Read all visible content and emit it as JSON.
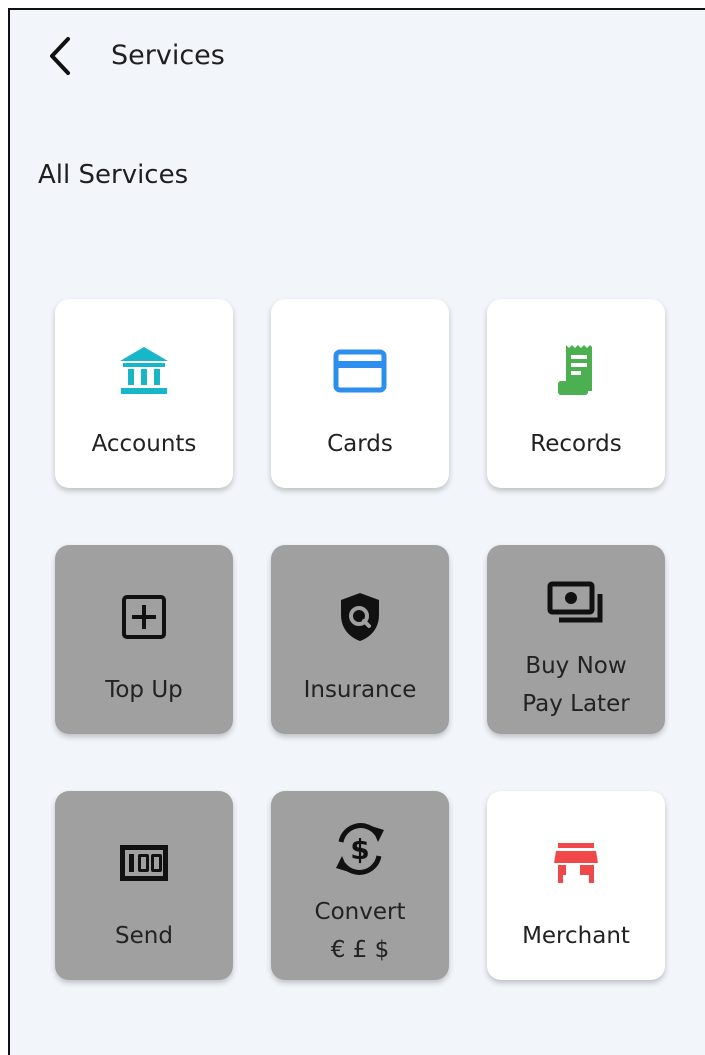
{
  "header": {
    "title": "Services",
    "back_icon": "chevron-left-icon"
  },
  "section": {
    "title": "All Services"
  },
  "colors": {
    "enabled_tile": "#ffffff",
    "disabled_tile": "#a0a0a0",
    "accounts_icon": "#17b6c9",
    "cards_icon": "#2d8ef0",
    "records_icon": "#4caf50",
    "merchant_icon": "#f04848"
  },
  "services": [
    {
      "label": "Accounts",
      "icon": "bank-icon",
      "enabled": true
    },
    {
      "label": "Cards",
      "icon": "credit-card-icon",
      "enabled": true
    },
    {
      "label": "Records",
      "icon": "receipt-icon",
      "enabled": true
    },
    {
      "label": "Top Up",
      "icon": "add-box-icon",
      "enabled": false
    },
    {
      "label": "Insurance",
      "icon": "shield-search-icon",
      "enabled": false
    },
    {
      "label_line1": "Buy Now",
      "label_line2": "Pay Later",
      "icon": "money-stack-icon",
      "enabled": false
    },
    {
      "label": "Send",
      "icon": "cash-100-icon",
      "enabled": false
    },
    {
      "label_line1": "Convert",
      "label_line2": "€ £ $",
      "icon": "currency-exchange-icon",
      "enabled": false
    },
    {
      "label": "Merchant",
      "icon": "storefront-icon",
      "enabled": true
    }
  ]
}
